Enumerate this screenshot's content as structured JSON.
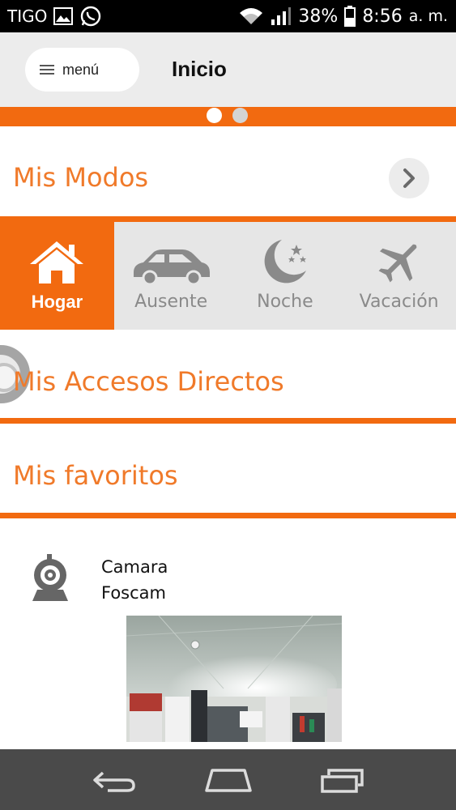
{
  "status_bar": {
    "carrier": "TIGO",
    "battery": "38%",
    "time": "8:56",
    "ampm": "a. m.",
    "icons": [
      "image-icon",
      "whatsapp-icon",
      "wifi-icon",
      "signal-icon",
      "battery-icon"
    ]
  },
  "header": {
    "menu_label": "menú",
    "title": "Inicio"
  },
  "pager": {
    "pages": 2,
    "active": 0
  },
  "sections": {
    "modes_title": "Mis Modos",
    "shortcuts_title": "Mis Accesos Directos",
    "favorites_title": "Mis favoritos"
  },
  "modes": [
    {
      "label": "Hogar",
      "icon": "house-icon",
      "active": true
    },
    {
      "label": "Ausente",
      "icon": "car-icon",
      "active": false
    },
    {
      "label": "Noche",
      "icon": "moon-icon",
      "active": false
    },
    {
      "label": "Vacación",
      "icon": "airplane-icon",
      "active": false
    }
  ],
  "favorites": [
    {
      "name_line1": "Camara",
      "name_line2": "Foscam",
      "icon": "camera-icon"
    }
  ],
  "navbar": {
    "icons": [
      "back-icon",
      "home-icon",
      "recents-icon"
    ]
  },
  "colors": {
    "accent": "#f26a10",
    "title_orange": "#f07a2a",
    "header_bg": "#ececec",
    "modes_bg": "#e6e6e6",
    "navbar_bg": "#4a4a4a"
  }
}
